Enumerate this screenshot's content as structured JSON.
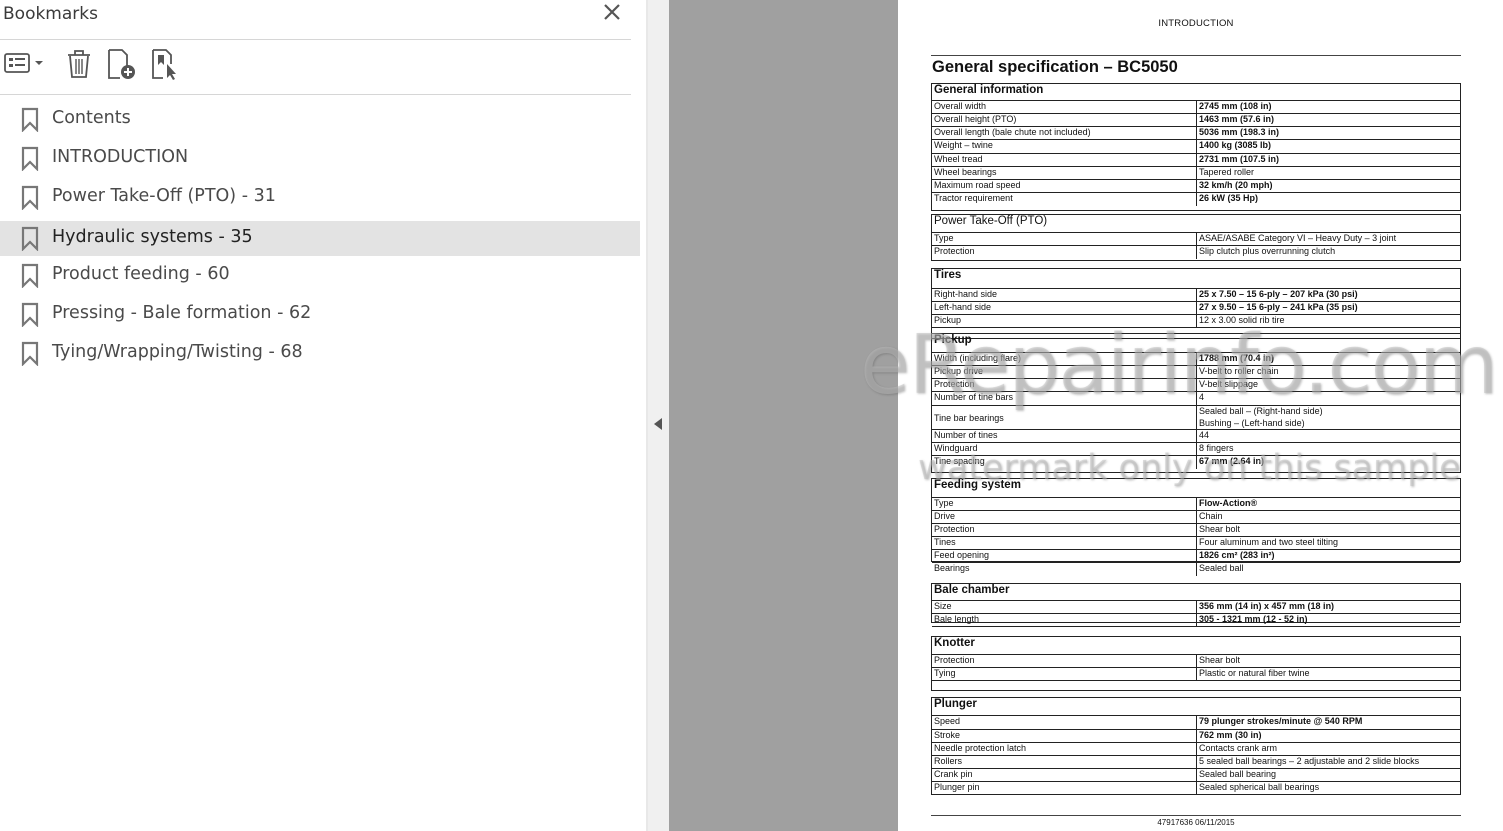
{
  "bookmarks_panel": {
    "title": "Bookmarks",
    "toolbar": {
      "options_icon": "options-list-icon",
      "delete_icon": "trash-icon",
      "new_bookmark_icon": "new-bookmark-icon",
      "find_bookmark_icon": "find-current-bookmark-icon"
    },
    "items": [
      {
        "label": "Contents",
        "selected": false
      },
      {
        "label": "INTRODUCTION",
        "selected": false
      },
      {
        "label": "Power Take-Off (PTO) - 31",
        "selected": false
      },
      {
        "label": "Hydraulic systems - 35",
        "selected": true
      },
      {
        "label": "Product feeding - 60",
        "selected": false
      },
      {
        "label": "Pressing - Bale formation - 62",
        "selected": false
      },
      {
        "label": "Tying/Wrapping/Twisting - 68",
        "selected": false
      }
    ]
  },
  "document": {
    "header": "INTRODUCTION",
    "title": "General specification – BC5050",
    "sections": [
      {
        "heading": "General information",
        "rows": [
          {
            "label": "Overall width",
            "value": "2745 mm (108 in)",
            "bold": true
          },
          {
            "label": "Overall height (PTO)",
            "value": "1463 mm (57.6 in)",
            "bold": true
          },
          {
            "label": "Overall length (bale chute not included)",
            "value": "5036 mm (198.3 in)",
            "bold": true
          },
          {
            "label": "Weight – twine",
            "value": "1400 kg (3085 lb)",
            "bold": true
          },
          {
            "label": "Wheel tread",
            "value": "2731 mm (107.5 in)",
            "bold": true
          },
          {
            "label": "Wheel bearings",
            "value": "Tapered roller",
            "bold": false
          },
          {
            "label": "Maximum road speed",
            "value": "32 km/h (20 mph)",
            "bold": true
          },
          {
            "label": "Tractor requirement",
            "value": "26 kW (35 Hp)",
            "bold": true
          }
        ]
      },
      {
        "heading": "Power Take-Off (PTO)",
        "heading_bold": false,
        "rows": [
          {
            "label": "Type",
            "value": "ASAE/ASABE Category VI – Heavy Duty – 3 joint",
            "bold": false
          },
          {
            "label": "Protection",
            "value": "Slip clutch plus overrunning clutch",
            "bold": false
          }
        ]
      },
      {
        "heading": "Tires",
        "rows": [
          {
            "label": "Right-hand side",
            "value": "25 x 7.50 – 15 6-ply – 207 kPa (30 psi)",
            "bold": true
          },
          {
            "label": "Left-hand side",
            "value": "27 x 9.50 – 15 6-ply – 241 kPa (35 psi)",
            "bold": true
          },
          {
            "label": "Pickup",
            "value": "12 x 3.00 solid rib tire",
            "bold": false
          }
        ]
      },
      {
        "heading": "Pickup",
        "rows": [
          {
            "label": "Width (including flare)",
            "value": "1788 mm (70.4 in)",
            "bold": true
          },
          {
            "label": "Pickup drive",
            "value": "V-belt to roller chain",
            "bold": false
          },
          {
            "label": "Protection",
            "value": "V-belt slippage",
            "bold": false
          },
          {
            "label": "Number of tine bars",
            "value": "4",
            "bold": false
          },
          {
            "label": "Tine bar bearings",
            "value": "Sealed ball – (Right-hand side)",
            "value2": "Bushing – (Left-hand side)",
            "bold": false
          },
          {
            "label": "Number of tines",
            "value": "44",
            "bold": false
          },
          {
            "label": "Windguard",
            "value": "8 fingers",
            "bold": false
          },
          {
            "label": "Tine spacing",
            "value": "67 mm (2.64 in)",
            "bold": true
          }
        ]
      },
      {
        "heading": "Feeding system",
        "rows": [
          {
            "label": "Type",
            "value": "Flow-Action®",
            "bold": true
          },
          {
            "label": "Drive",
            "value": "Chain",
            "bold": false
          },
          {
            "label": "Protection",
            "value": "Shear bolt",
            "bold": false
          },
          {
            "label": "Tines",
            "value": "Four aluminum and two steel tilting",
            "bold": false
          },
          {
            "label": "Feed opening",
            "value": "1826 cm² (283 in²)",
            "bold": true
          },
          {
            "label": "Bearings",
            "value": "Sealed ball",
            "bold": false
          }
        ]
      },
      {
        "heading": "Bale chamber",
        "rows": [
          {
            "label": "Size",
            "value": "356 mm (14 in) x 457 mm (18 in)",
            "bold": true
          },
          {
            "label": "Bale length",
            "value": "305 - 1321 mm (12 - 52 in)",
            "bold": true
          }
        ]
      },
      {
        "heading": "Knotter",
        "rows": [
          {
            "label": "Protection",
            "value": "Shear bolt",
            "bold": false
          },
          {
            "label": "Tying",
            "value": "Plastic or natural fiber twine",
            "bold": false
          }
        ]
      },
      {
        "heading": "Plunger",
        "rows": [
          {
            "label": "Speed",
            "value": "79 plunger strokes/minute @ 540 RPM",
            "bold": true
          },
          {
            "label": "Stroke",
            "value": "762 mm (30 in)",
            "bold": true
          },
          {
            "label": "Needle protection latch",
            "value": "Contacts crank arm",
            "bold": false
          },
          {
            "label": "Rollers",
            "value": "5 sealed ball bearings – 2 adjustable and 2 slide blocks",
            "bold": false
          },
          {
            "label": "Crank pin",
            "value": "Sealed ball bearing",
            "bold": false
          },
          {
            "label": "Plunger pin",
            "value": "Sealed spherical ball bearings",
            "bold": false
          }
        ]
      }
    ],
    "footer": "47917636 06/11/2015"
  },
  "watermark": {
    "line1": "eRepairinfo.com",
    "line2": "watermark only on this sample"
  }
}
